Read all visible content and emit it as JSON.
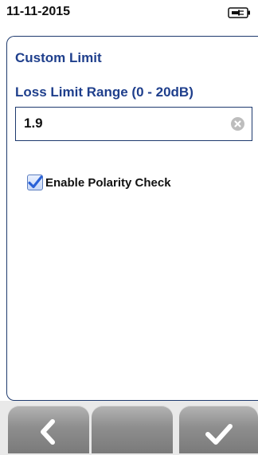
{
  "status_bar": {
    "date": "11-11-2015"
  },
  "page": {
    "title": "Custom Limit"
  },
  "loss_limit": {
    "label": "Loss Limit Range (0 - 20dB)",
    "value": "1.9"
  },
  "polarity": {
    "label": "Enable Polarity Check",
    "checked": true
  },
  "toolbar": {
    "back_icon": "chevron-left-icon",
    "ok_icon": "checkmark-icon"
  },
  "colors": {
    "accent": "#1f3f8c",
    "border": "#1e3a6e",
    "button": "#8e8e8e"
  }
}
